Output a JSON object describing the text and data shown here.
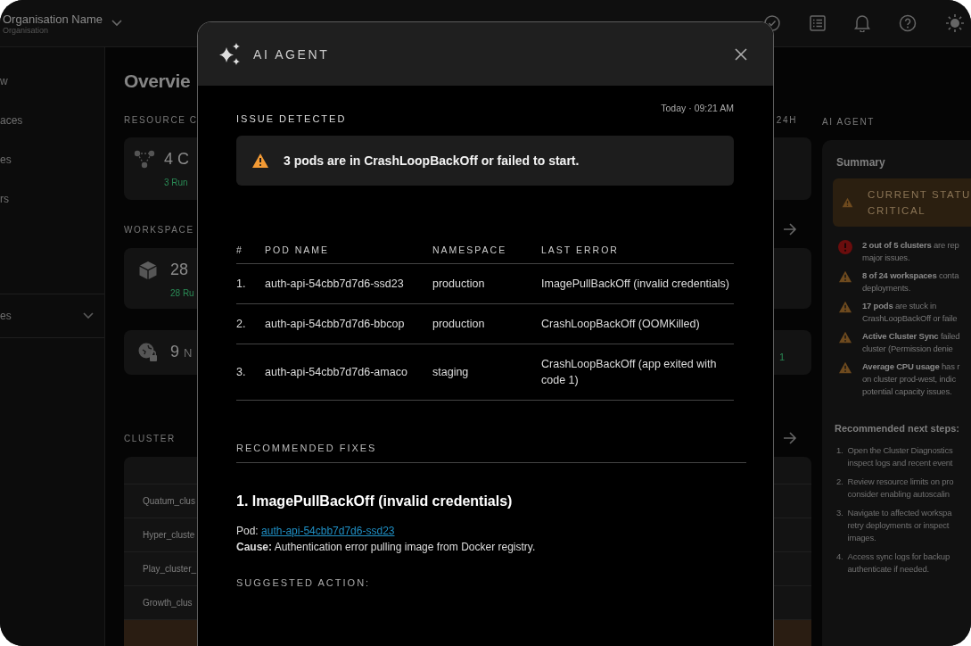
{
  "topbar": {
    "org_name": "Organisation Name",
    "org_subtitle": "Organisation"
  },
  "sidebar": {
    "items": [
      {
        "label": "w"
      },
      {
        "label": "aces"
      },
      {
        "label": "es"
      },
      {
        "label": "rs"
      }
    ],
    "groups": [
      {
        "label": "es",
        "expanded": false
      }
    ]
  },
  "overview": {
    "title": "Overvie",
    "resource": {
      "heading": "RESOURCE C",
      "period": "24H",
      "card": {
        "value": "4 C",
        "status": "3 Run"
      }
    },
    "workspace": {
      "heading": "WORKSPACE",
      "cards": [
        {
          "kind": "cube",
          "value": "28",
          "status": "28 Ru"
        },
        {
          "kind": "globe-lock",
          "value": "9",
          "unit": "N",
          "side_status": "1"
        }
      ]
    },
    "cluster": {
      "heading": "CLUSTER",
      "rows": [
        {
          "name": "Quatum_clus",
          "selected": false
        },
        {
          "name": "Hyper_cluste",
          "selected": false
        },
        {
          "name": "Play_cluster_",
          "selected": false
        },
        {
          "name": "Growth_clus",
          "selected": false
        },
        {
          "selected": true
        }
      ]
    }
  },
  "ai_panel": {
    "heading": "AI AGENT",
    "title": "Summary",
    "status": {
      "label": "CURRENT STATU",
      "value": "CRITICAL"
    },
    "findings": [
      {
        "kind": "error",
        "lines": [
          "**2 out of 5 clusters** are rep",
          "major issues."
        ]
      },
      {
        "kind": "warning",
        "lines": [
          "**8 of 24 workspaces** conta",
          "deployments."
        ]
      },
      {
        "kind": "warning",
        "lines": [
          "**17 pods** are stuck in",
          "CrashLoopBackOff or faile"
        ]
      },
      {
        "kind": "warning",
        "lines": [
          "**Active Cluster Sync** failed",
          "cluster (Permission denie"
        ]
      },
      {
        "kind": "warning",
        "lines": [
          "**Average CPU usage** has r",
          "on cluster prod-west, indic",
          "potential capacity issues."
        ]
      }
    ],
    "next_steps_title": "Recommended next steps:",
    "next_steps": [
      {
        "number": "1.",
        "lines": [
          "Open the Cluster Diagnostics",
          "inspect logs and recent event"
        ]
      },
      {
        "number": "2.",
        "lines": [
          "Review resource limits on pro",
          "consider enabling autoscalin"
        ]
      },
      {
        "number": "3.",
        "lines": [
          "Navigate to affected workspa",
          "retry deployments or inspect",
          "images."
        ]
      },
      {
        "number": "4.",
        "lines": [
          "Access sync logs for backup",
          "authenticate if needed."
        ]
      }
    ]
  },
  "modal": {
    "title": "AI AGENT",
    "timestamp": "Today · 09:21 AM",
    "issue_heading": "ISSUE DETECTED",
    "issue": {
      "kind": "warning",
      "text": "3 pods are in CrashLoopBackOff or failed to start."
    },
    "table": {
      "columns": [
        "#",
        "POD NAME",
        "NAMESPACE",
        "LAST ERROR"
      ],
      "rows": [
        [
          "1.",
          "auth-api-54cbb7d7d6-ssd23",
          "production",
          "ImagePullBackOff (invalid credentials)"
        ],
        [
          "2.",
          "auth-api-54cbb7d7d6-bbcop",
          "production",
          "CrashLoopBackOff (OOMKilled)"
        ],
        [
          "3.",
          "auth-api-54cbb7d7d6-amaco",
          "staging",
          "CrashLoopBackOff (app exited with code 1)"
        ]
      ]
    },
    "fixes_heading": "RECOMMENDED FIXES",
    "fixes": [
      {
        "title": "1. ImagePullBackOff (invalid credentials)",
        "pod_label": "Pod:",
        "pod": "auth-api-54cbb7d7d6-ssd23",
        "cause": "**Cause:** Authentication error pulling image from Docker registry.",
        "action_heading": "SUGGESTED ACTION:"
      }
    ]
  }
}
